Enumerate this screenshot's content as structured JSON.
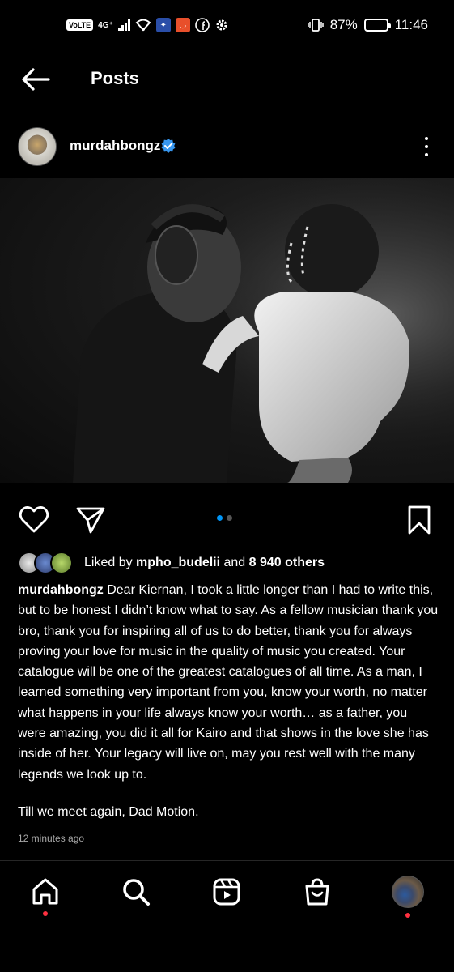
{
  "status_bar": {
    "volte": "VoLTE",
    "network": "4G⁺",
    "battery": "87%",
    "time": "11:46"
  },
  "header": {
    "title": "Posts",
    "back_icon": "arrow-left-icon"
  },
  "post": {
    "username": "murdahbongz",
    "verified": true,
    "image_count": 2,
    "active_image_index": 0,
    "likes": {
      "prefix": "Liked by ",
      "user": "mpho_budelii",
      "joiner": " and ",
      "others": "8 940 others"
    },
    "caption_user": "murdahbongz",
    "caption_text": " Dear Kiernan, I took a little longer than I had to write this, but to be honest I didn’t know what to say. As a fellow musician thank you bro, thank you for inspiring all of us to do better, thank you for always proving your love for music in the quality of music you created. Your catalogue will be one of the greatest catalogues of all time. As a man, I learned something very important from you, know your worth, no matter what happens in your life always know your worth… as a father, you were amazing, you did it all for Kairo and that shows in the love she has inside of her. Your legacy will live on, may you rest well with the many legends we look up to.",
    "caption_closing": "Till we meet again, Dad Motion.",
    "timestamp": "12 minutes ago"
  },
  "colors": {
    "background": "#000000",
    "verified_blue": "#3797f0",
    "active_dot": "#0095f6",
    "inactive_dot": "#555555",
    "notification_dot": "#ff3040"
  },
  "bottom_nav": {
    "items": [
      "home-icon",
      "search-icon",
      "reels-icon",
      "shop-icon",
      "profile-avatar"
    ]
  }
}
